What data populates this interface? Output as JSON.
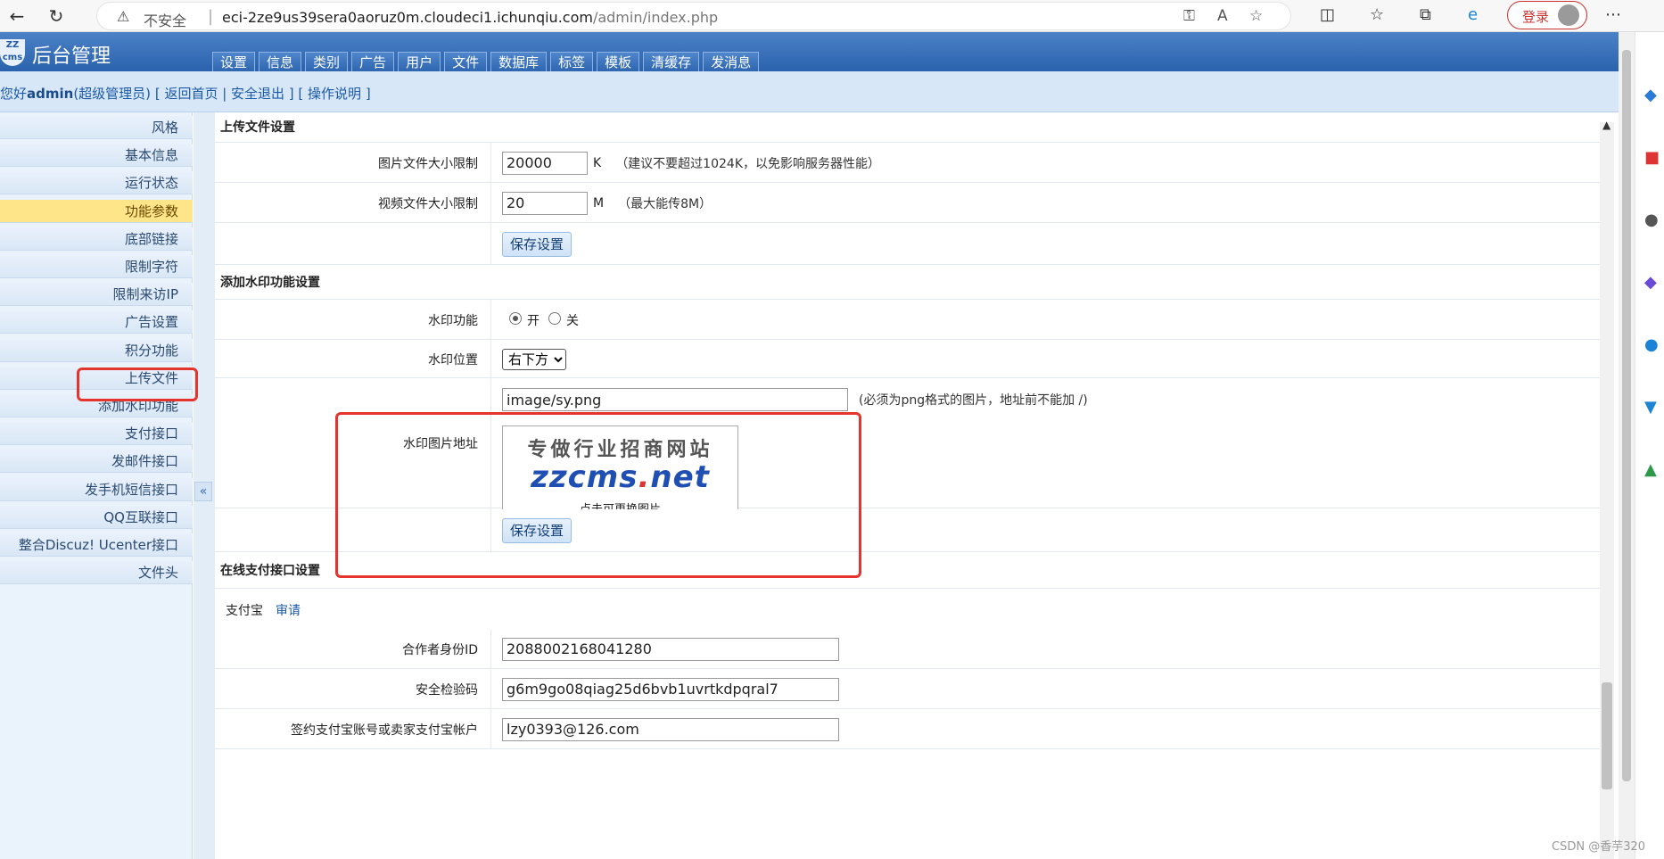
{
  "browser": {
    "insecure_label": "不安全",
    "url_host": "eci-2ze9us39sera0aoruz0m.cloudeci1.ichunqiu.com",
    "url_path": "/admin/index.php",
    "login_label": "登录"
  },
  "header": {
    "logo_text": "ZZ cms",
    "title": "后台管理",
    "tabs": [
      "设置",
      "信息",
      "类别",
      "广告",
      "用户",
      "文件",
      "数据库",
      "标签",
      "模板",
      "清缓存",
      "发消息"
    ]
  },
  "userbar": {
    "greeting": "您好",
    "username": "admin",
    "role": "(超级管理员)",
    "links": "[ 返回首页 | 安全退出 ] [ 操作说明 ]"
  },
  "sidebar": {
    "items": [
      "风格",
      "基本信息",
      "运行状态",
      "功能参数",
      "底部链接",
      "限制字符",
      "限制来访IP",
      "广告设置",
      "积分功能",
      "上传文件",
      "添加水印功能",
      "支付接口",
      "发邮件接口",
      "发手机短信接口",
      "QQ互联接口",
      "整合Discuz! Ucenter接口",
      "文件头"
    ],
    "active_index": 3,
    "collapse_symbol": "«"
  },
  "upload": {
    "heading": "上传文件设置",
    "img_label": "图片文件大小限制",
    "img_value": "20000",
    "img_unit": "K",
    "img_hint": "（建议不要超过1024K，以免影响服务器性能）",
    "video_label": "视频文件大小限制",
    "video_value": "20",
    "video_unit": "M",
    "video_hint": "（最大能传8M）",
    "save": "保存设置"
  },
  "watermark": {
    "heading": "添加水印功能设置",
    "func_label": "水印功能",
    "on_label": "开",
    "off_label": "关",
    "pos_label": "水印位置",
    "pos_value": "右下方",
    "img_label": "水印图片地址",
    "img_value": "image/sy.png",
    "img_hint": "(必须为png格式的图片，地址前不能加 /)",
    "preview_line1": "专做行业招商网站",
    "preview_brand": "zzcms",
    "preview_dot": ".",
    "preview_tld": "net",
    "preview_caption": "点击可更换图片",
    "save": "保存设置"
  },
  "payment": {
    "heading": "在线支付接口设置",
    "alipay_label": "支付宝",
    "apply_link": "审请",
    "partner_label": "合作者身份ID",
    "partner_value": "2088002168041280",
    "key_label": "安全检验码",
    "key_value": "g6m9go08qiag25d6bvb1uvrtkdpqral7",
    "account_label": "签约支付宝账号或卖家支付宝帐户",
    "account_value": "lzy0393@126.com"
  },
  "footer": "CSDN @香芋320",
  "colors": {
    "accent": "#2a62ad",
    "highlight": "#e5332d",
    "active_item": "#ffe58a"
  }
}
